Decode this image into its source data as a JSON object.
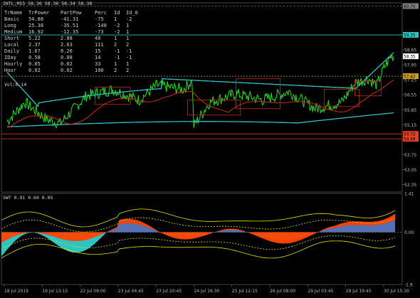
{
  "chart_title": "INTL,M15",
  "chart_ohlc": "58.36 58.36 58.34 58.38",
  "volume_label": "Vol:0.14",
  "indicator_title": "SWT 0.91 0.60 0.05",
  "table": {
    "headers": [
      "TrName",
      "TrPower",
      "PartPow",
      "Perc",
      "Id",
      "Id_0"
    ],
    "rows": [
      [
        "Basic",
        "54.88",
        "-41.31",
        "-75",
        "1",
        "-2"
      ],
      [
        "Long",
        "25.38",
        "-35.51",
        "-140",
        "-2",
        "1"
      ],
      [
        "Medium",
        "16.92",
        "-12.35",
        "-73",
        "-2",
        "1"
      ],
      [
        "Short",
        "5.22",
        "2.08",
        "40",
        "1",
        "1"
      ],
      [
        "Local",
        "2.37",
        "2.63",
        "111",
        "2",
        "2"
      ],
      [
        "Daily",
        "1.67",
        "0.26",
        "15",
        "-1",
        "-1"
      ],
      [
        "IDay",
        "0.58",
        "0.08",
        "14",
        "-1",
        "-1"
      ],
      [
        "Hourly",
        "0.05",
        "0.02",
        "33",
        "1",
        "1"
      ],
      [
        "Hour",
        "0.02",
        "0.02",
        "100",
        "2",
        "2"
      ]
    ]
  },
  "price_axis": {
    "labels": [
      "60.70",
      "59.35",
      "58.65",
      "57.95",
      "57.25",
      "56.55",
      "55.85",
      "55.15",
      "54.45",
      "53.75",
      "53.05",
      "52.35"
    ],
    "tags": [
      {
        "value": "60.70",
        "color": "#808080"
      },
      {
        "value": "59.35",
        "color": "#2ec4c4"
      },
      {
        "value": "58.35",
        "color": "#ffffff"
      },
      {
        "value": "57.42",
        "color": "#c8a020"
      },
      {
        "value": "54.72",
        "color": "#e04020"
      },
      {
        "value": "54.49",
        "color": "#e04020"
      }
    ]
  },
  "indicator_axis": {
    "labels": [
      "1.41",
      "0.00",
      "-1.9"
    ]
  },
  "time_axis": {
    "labels": [
      "18 Jul 2019",
      "19 Jul 13:15",
      "22 Jul 09:00",
      "23 Jul 04:45",
      "23 Jul 20:45",
      "24 Jul 16:30",
      "25 Jul 12:15",
      "26 Jul 08:00",
      "29 Jul 03:45",
      "29 Jul 19:45",
      "30 Jul 15:30"
    ]
  },
  "colors": {
    "background": "#000000",
    "price_line": "#22dd22",
    "ma_cyan": "#2ec4c4",
    "ma_red": "#c83010",
    "level_dashed": "#c8a020",
    "grid": "#2a2a2a",
    "histo_orange": "#ff4400",
    "histo_teal": "#2ec4c4",
    "histo_blue": "#3a7ad0",
    "band_yellow": "#e8e000"
  }
}
